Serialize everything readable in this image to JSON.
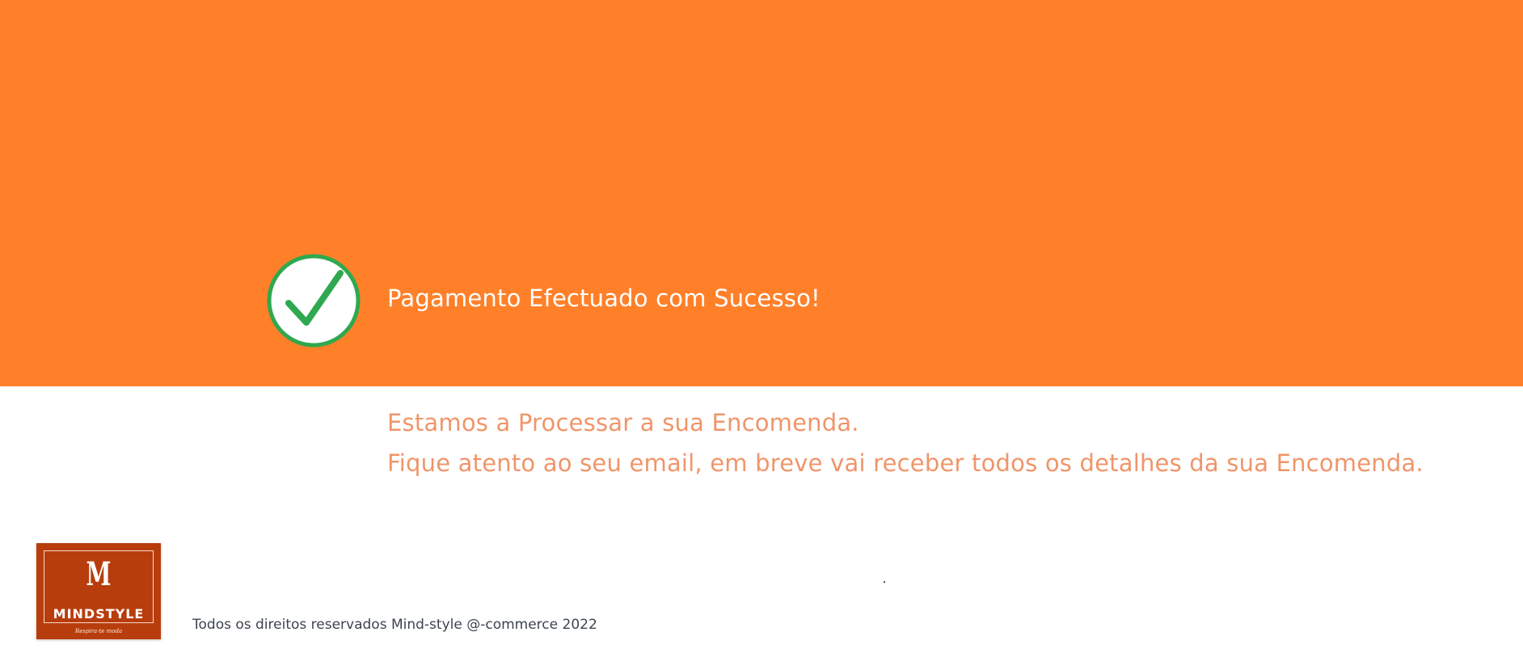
{
  "hero": {
    "background_color": "#ff8028",
    "icon": "check-circle-icon",
    "icon_color": "#2fa84f",
    "title": "Pagamento Efectuado com Sucesso!"
  },
  "message": {
    "line1": "Estamos a Processar a sua Encomenda.",
    "line2": "Fique atento ao seu email, em breve vai receber todos os detalhes da sua Encomenda.",
    "color": "#f0956a"
  },
  "footer": {
    "logo": {
      "name": "MINDSTYLE",
      "monogram": "M",
      "tagline": "Respira-te moda",
      "color": "#b83d0d"
    },
    "copyright": "Todos os direitos reservados Mind-style @-commerce 2022"
  }
}
